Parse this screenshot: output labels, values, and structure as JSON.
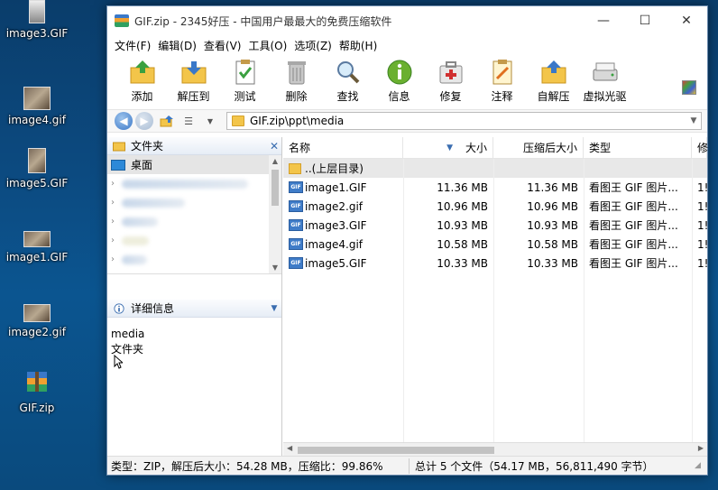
{
  "desktop": {
    "icons": [
      {
        "label": "image3.GIF"
      },
      {
        "label": "image4.gif"
      },
      {
        "label": "image5.GIF"
      },
      {
        "label": "image1.GIF"
      },
      {
        "label": "image2.gif"
      },
      {
        "label": "GIF.zip"
      }
    ]
  },
  "window": {
    "title": "GIF.zip - 2345好压 - 中国用户最最大的免费压缩软件",
    "controls": {
      "minimize": "—",
      "maximize": "☐",
      "close": "✕"
    }
  },
  "menu": [
    "文件(F)",
    "编辑(D)",
    "查看(V)",
    "工具(O)",
    "选项(Z)",
    "帮助(H)"
  ],
  "toolbar": [
    {
      "label": "添加",
      "icon": "add-icon"
    },
    {
      "label": "解压到",
      "icon": "extract-icon"
    },
    {
      "label": "测试",
      "icon": "test-icon"
    },
    {
      "label": "删除",
      "icon": "delete-icon"
    },
    {
      "label": "查找",
      "icon": "find-icon"
    },
    {
      "label": "信息",
      "icon": "info-icon"
    },
    {
      "label": "修复",
      "icon": "repair-icon"
    },
    {
      "label": "注释",
      "icon": "comment-icon"
    },
    {
      "label": "自解压",
      "icon": "sfx-icon"
    },
    {
      "label": "虚拟光驱",
      "icon": "virtual-drive-icon"
    }
  ],
  "address": {
    "path": "GIF.zip\\ppt\\media"
  },
  "left_pane": {
    "folders_title": "文件夹",
    "close": "✕",
    "tree_selected": "桌面",
    "details_title": "详细信息",
    "details_name": "media",
    "details_type": "文件夹"
  },
  "file_list": {
    "columns": {
      "name": "名称",
      "size": "大小",
      "csize": "压缩后大小",
      "type": "类型",
      "more": "修"
    },
    "up_label": "..(上层目录)",
    "rows": [
      {
        "name": "image1.GIF",
        "size": "11.36 MB",
        "csize": "11.36 MB",
        "type": "看图王 GIF 图片...",
        "more": "1!"
      },
      {
        "name": "image2.gif",
        "size": "10.96 MB",
        "csize": "10.96 MB",
        "type": "看图王 GIF 图片...",
        "more": "1!"
      },
      {
        "name": "image3.GIF",
        "size": "10.93 MB",
        "csize": "10.93 MB",
        "type": "看图王 GIF 图片...",
        "more": "1!"
      },
      {
        "name": "image4.gif",
        "size": "10.58 MB",
        "csize": "10.58 MB",
        "type": "看图王 GIF 图片...",
        "more": "1!"
      },
      {
        "name": "image5.GIF",
        "size": "10.33 MB",
        "csize": "10.33 MB",
        "type": "看图王 GIF 图片...",
        "more": "1!"
      }
    ]
  },
  "status": {
    "left": "类型：ZIP，解压后大小：54.28 MB，压缩比：99.86%",
    "right": "总计 5 个文件（54.17 MB，56,811,490 字节）"
  }
}
